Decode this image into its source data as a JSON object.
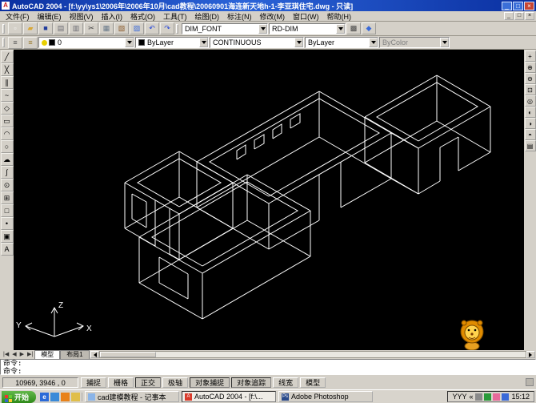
{
  "window": {
    "title": "AutoCAD 2004 - [f:\\yy\\ys1\\2006年\\2006年10月\\cad教程\\20060901海连新天地h-1-李亚琪住宅.dwg - 只读]",
    "app_initial": "A",
    "min": "_",
    "max": "□",
    "close": "×"
  },
  "menu": {
    "items": [
      "文件(F)",
      "编辑(E)",
      "视图(V)",
      "插入(I)",
      "格式(O)",
      "工具(T)",
      "绘图(D)",
      "标注(N)",
      "修改(M)",
      "窗口(W)",
      "帮助(H)"
    ],
    "mdi_min": "_",
    "mdi_restore": "□",
    "mdi_close": "×"
  },
  "toolbars": {
    "row1_icons": [
      {
        "name": "new-file-icon",
        "glyph": "▫",
        "color": "#f8f8f8"
      },
      {
        "name": "open-file-icon",
        "glyph": "▰",
        "color": "#d8a838"
      },
      {
        "name": "save-icon",
        "glyph": "■",
        "color": "#223c9c"
      },
      {
        "name": "print-icon",
        "glyph": "▤",
        "color": "#6a6a72"
      },
      {
        "name": "print-preview-icon",
        "glyph": "▥",
        "color": "#6a6a72"
      },
      {
        "name": "cut-icon",
        "glyph": "✂",
        "color": "#444444"
      },
      {
        "name": "copy-icon",
        "glyph": "▦",
        "color": "#667788"
      },
      {
        "name": "paste-icon",
        "glyph": "▧",
        "color": "#8a5a2a"
      },
      {
        "name": "match-properties-icon",
        "glyph": "▨",
        "color": "#3a6ad8"
      },
      {
        "name": "undo-icon",
        "glyph": "↶",
        "color": "#2a4ad8"
      },
      {
        "name": "redo-icon",
        "glyph": "↷",
        "color": "#2a4ad8"
      }
    ],
    "text_style_combo": {
      "value": "DIM_FONT"
    },
    "dim_style_combo": {
      "value": "RD-DIM"
    },
    "row1_icons_after": [
      {
        "name": "properties-icon",
        "glyph": "▩",
        "color": "#444444"
      },
      {
        "name": "design-center-icon",
        "glyph": "◆",
        "color": "#3a6ad8"
      }
    ],
    "row2_icons": [
      {
        "name": "layer-properties-icon",
        "glyph": "≡",
        "color": "#555555"
      },
      {
        "name": "layer-states-icon",
        "glyph": "≡",
        "color": "#997a2a"
      }
    ],
    "layer_combo": {
      "value": "0",
      "bulb_color": "#e8cf00",
      "swatch_color": "#000000"
    },
    "color_combo": {
      "value": "ByLayer",
      "swatch_color": "#000000"
    },
    "linetype_combo": {
      "value": "CONTINUOUS"
    },
    "lineweight_combo": {
      "value": "ByLayer"
    },
    "plotstyle_combo": {
      "value": "ByColor"
    },
    "draw_tools": [
      {
        "name": "line-tool-icon",
        "glyph": "╱"
      },
      {
        "name": "construction-line-tool-icon",
        "glyph": "╳"
      },
      {
        "name": "multiline-tool-icon",
        "glyph": "∥"
      },
      {
        "name": "polyline-tool-icon",
        "glyph": "~"
      },
      {
        "name": "polygon-tool-icon",
        "glyph": "◇"
      },
      {
        "name": "rectangle-tool-icon",
        "glyph": "▭"
      },
      {
        "name": "arc-tool-icon",
        "glyph": "◠"
      },
      {
        "name": "circle-tool-icon",
        "glyph": "○"
      },
      {
        "name": "revision-cloud-tool-icon",
        "glyph": "☁"
      },
      {
        "name": "spline-tool-icon",
        "glyph": "∫"
      },
      {
        "name": "ellipse-tool-icon",
        "glyph": "⊙"
      },
      {
        "name": "insert-block-tool-icon",
        "glyph": "⊞"
      },
      {
        "name": "make-block-tool-icon",
        "glyph": "□"
      },
      {
        "name": "point-tool-icon",
        "glyph": "•"
      },
      {
        "name": "hatch-tool-icon",
        "glyph": "▣"
      },
      {
        "name": "mtext-tool-icon",
        "glyph": "A"
      }
    ],
    "view_tools": [
      {
        "name": "pan-tool-icon",
        "glyph": "+"
      },
      {
        "name": "zoom-in-tool-icon",
        "glyph": "⊕"
      },
      {
        "name": "zoom-out-tool-icon",
        "glyph": "⊖"
      },
      {
        "name": "zoom-window-tool-icon",
        "glyph": "⊡"
      },
      {
        "name": "orbit-tool-icon",
        "glyph": "◎"
      },
      {
        "name": "hide-tool-icon",
        "glyph": "◐"
      },
      {
        "name": "shade-tool-icon",
        "glyph": "◑"
      },
      {
        "name": "render-tool-icon",
        "glyph": "◓"
      },
      {
        "name": "named-views-tool-icon",
        "glyph": "▤"
      }
    ]
  },
  "drawing": {
    "background": "#000000",
    "stroke": "#ffffff",
    "ucs": {
      "x_label": "X",
      "y_label": "Y",
      "z_label": "Z"
    },
    "paths": [
      "253,398 388,320",
      "253,398 174,353",
      "388,320 309,275",
      "174,353 309,275",
      "253,341 388,263",
      "388,263 309,218",
      "309,218 174,296",
      "174,296 253,341",
      "253,398 253,341",
      "388,320 388,263",
      "174,353 174,296",
      "309,275 309,218",
      "253,332 372,263 309,227 190,296 253,332",
      "235,373 199,353",
      "235,342 199,321",
      "235,373 235,342",
      "199,353 199,321",
      "224,324 291,285",
      "291,285 224,246",
      "224,246 156,285",
      "224,267 291,228",
      "291,228 224,189",
      "224,189 156,228",
      "291,285 291,228",
      "224,246 224,189",
      "224,324 212,317",
      "194,307 156,285",
      "224,267 156,228",
      "224,324 224,267",
      "156,285 156,228",
      "212,317 212,260",
      "194,307 194,250",
      "183,284 165,273",
      "183,252 165,242",
      "183,284 183,252",
      "165,273 165,242",
      "224,258 276,228 224,198 172,228 224,258",
      "246,259 336,311",
      "246,259 399,171",
      "399,171 489,223",
      "336,311 399,275",
      "426,259 489,223",
      "336,254 489,166",
      "489,166 399,114",
      "399,114 246,202",
      "246,202 336,254",
      "336,311 336,254",
      "489,223 489,166",
      "246,259 246,202",
      "399,171 399,114",
      "399,275 399,218",
      "426,259 426,202",
      "336,245 474,166 399,123 262,202 336,245",
      "296,199 307,192 307,181 296,188 296,199",
      "318,186 330,179 330,168 318,175 318,186",
      "341,173 352,166 352,155 341,162 341,173",
      "363,160 375,153 375,142 363,149 363,160",
      "523,242 456,203",
      "456,203 546,151",
      "546,151 613,190",
      "523,242 550,226",
      "573,213 613,190",
      "523,242 489,223",
      "523,185 613,133",
      "613,133 546,94",
      "546,94 456,146",
      "456,146 523,185",
      "523,185 489,166",
      "523,242 523,185",
      "613,190 613,133",
      "546,151 546,94",
      "456,203 456,146",
      "550,226 550,184",
      "573,213 573,171",
      "550,184 573,171",
      "523,176 597,133 546,103 471,146 523,176"
    ]
  },
  "tabs": {
    "nav": [
      "|◀",
      "◀",
      "▶",
      "▶|"
    ],
    "items": [
      {
        "label": "模型",
        "active": true
      },
      {
        "label": "布局1",
        "active": false
      }
    ]
  },
  "command": {
    "history": "命令:",
    "prompt": "命令:"
  },
  "status": {
    "coords": "10969, 3946 , 0",
    "buttons": [
      {
        "label": "捕捉",
        "pressed": false
      },
      {
        "label": "栅格",
        "pressed": false
      },
      {
        "label": "正交",
        "pressed": true
      },
      {
        "label": "极轴",
        "pressed": false
      },
      {
        "label": "对象捕捉",
        "pressed": true
      },
      {
        "label": "对象追踪",
        "pressed": true
      },
      {
        "label": "线宽",
        "pressed": false
      },
      {
        "label": "模型",
        "pressed": false
      }
    ]
  },
  "taskbar": {
    "start_label": "开始",
    "quicklaunch": [
      {
        "name": "ie-icon",
        "color": "#2a6ad8",
        "glyph": "e"
      },
      {
        "name": "show-desktop-icon",
        "color": "#3a8ad8",
        "glyph": ""
      },
      {
        "name": "media-player-icon",
        "color": "#e8821a",
        "glyph": ""
      },
      {
        "name": "folder-icon",
        "color": "#e0be4a",
        "glyph": ""
      }
    ],
    "tasks": [
      {
        "label": "cad建模教程 - 记事本",
        "icon_color": "#8ab4e8",
        "glyph": "",
        "active": false
      },
      {
        "label": "AutoCAD 2004 - [f:\\...",
        "icon_color": "#d83a2a",
        "glyph": "A",
        "active": true
      },
      {
        "label": "Adobe Photoshop",
        "icon_color": "#2a4a8a",
        "glyph": "Ps",
        "active": false
      }
    ],
    "tray": {
      "ime": "YYY",
      "chevron": "«",
      "time": "15:12",
      "icons": [
        {
          "name": "volume-icon",
          "color": "#8a8a8a"
        },
        {
          "name": "antivirus-icon",
          "color": "#2a9a3a"
        },
        {
          "name": "message-icon",
          "color": "#e86a9a"
        },
        {
          "name": "network-icon",
          "color": "#3a6ad8"
        }
      ]
    }
  }
}
